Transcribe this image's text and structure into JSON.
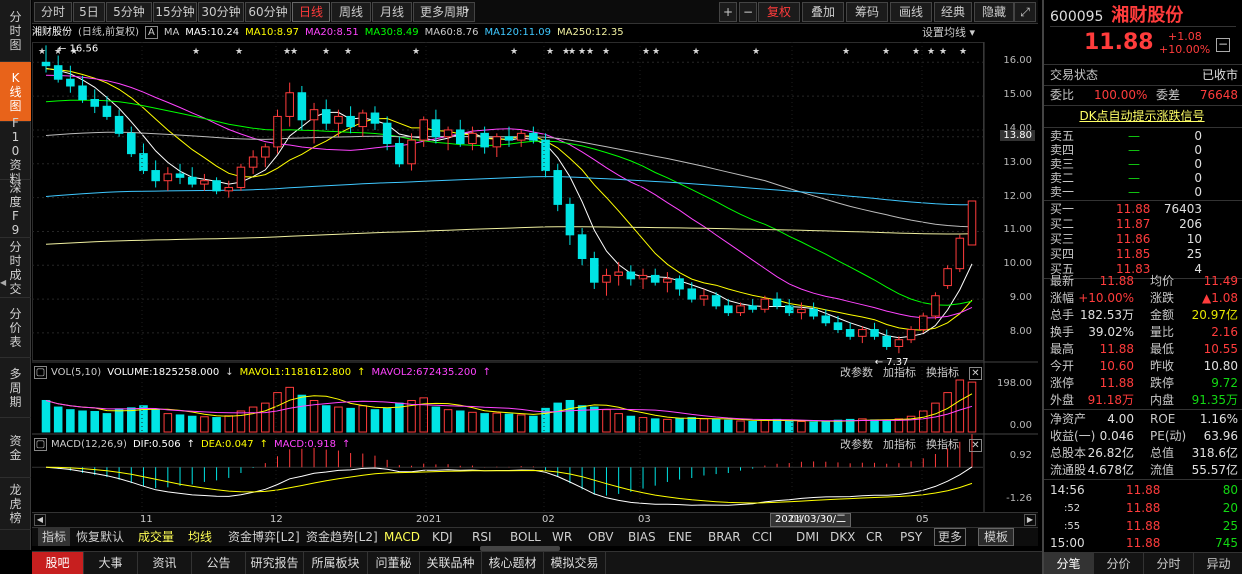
{
  "side_nav": [
    {
      "label": "分时图"
    },
    {
      "label": "K线图"
    },
    {
      "label": "F10资料"
    },
    {
      "label": "深度F9"
    },
    {
      "label": "分时成交"
    },
    {
      "label": "分价表"
    },
    {
      "label": "多周期"
    },
    {
      "label": "资金"
    },
    {
      "label": "龙虎榜"
    }
  ],
  "toolbar": {
    "periods": [
      "分时",
      "5日",
      "5分钟",
      "15分钟",
      "30分钟",
      "60分钟",
      "日线",
      "周线",
      "月线",
      "更多周期"
    ],
    "right": [
      "+",
      "−",
      "复权",
      "叠加",
      "筹码",
      "画线",
      "经典",
      "隐藏"
    ]
  },
  "chart_header": {
    "name": "湘财股份",
    "mode": "(日线,前复权)",
    "box": "A",
    "ma_label": "MA",
    "ma5": "MA5:10.24",
    "ma10": "MA10:8.97",
    "ma20": "MA20:8.51",
    "ma30": "MA30:8.49",
    "ma60": "MA60:8.76",
    "ma120": "MA120:11.09",
    "ma250": "MA250:12.35",
    "settings": "设置均线"
  },
  "price_axis": {
    "ticks": [
      "16.00",
      "15.00",
      "14.00",
      "13.80",
      "13.00",
      "12.00",
      "11.00",
      "10.00",
      "9.00",
      "8.00"
    ],
    "high_label": "16.56",
    "low_label": "7.37"
  },
  "volume_header": {
    "title": "VOL(5,10)",
    "volume": "VOLUME:1825258.000",
    "mavol1": "MAVOL1:1181612.800",
    "mavol2": "MAVOL2:672435.200"
  },
  "volume_axis": {
    "top": "198.00",
    "bottom": "0.00"
  },
  "macd_header": {
    "title": "MACD(12,26,9)",
    "dif": "DIF:0.506",
    "dea": "DEA:0.047",
    "macd": "MACD:0.918"
  },
  "macd_axis": {
    "top": "0.92",
    "bottom": "-1.26"
  },
  "sub_tools": {
    "t1": "改参数",
    "t2": "加指标",
    "t3": "换指标"
  },
  "date_bar": {
    "labels": [
      "11",
      "12",
      "2021",
      "02",
      "03",
      "04",
      "05"
    ],
    "current": "2021/03/30/二"
  },
  "indicator_tabs": [
    "指标",
    "恢复默认",
    "成交量",
    "均线",
    "资金博弈[L2]",
    "资金趋势[L2]",
    "MACD",
    "KDJ",
    "RSI",
    "BOLL",
    "WR",
    "OBV",
    "BIAS",
    "ENE",
    "BRAR",
    "CCI",
    "DMI",
    "DKX",
    "CR",
    "PSY",
    "更多",
    "模板"
  ],
  "bottom_tabs": [
    "股吧",
    "大事",
    "资讯",
    "公告",
    "研究报告",
    "所属板块",
    "问董秘",
    "关联品种",
    "核心题材",
    "模拟交易"
  ],
  "quote": {
    "code": "600095",
    "name": "湘财股份",
    "price": "11.88",
    "change": "+1.08",
    "pct": "+10.00%",
    "status_label": "交易状态",
    "status": "已收市",
    "weibi_label": "委比",
    "weibi": "100.00%",
    "weicha_label": "委差",
    "weicha": "76648",
    "signal": "DK点自动提示涨跌信号",
    "asks": [
      {
        "label": "卖五",
        "price": "—",
        "vol": "0"
      },
      {
        "label": "卖四",
        "price": "—",
        "vol": "0"
      },
      {
        "label": "卖三",
        "price": "—",
        "vol": "0"
      },
      {
        "label": "卖二",
        "price": "—",
        "vol": "0"
      },
      {
        "label": "卖一",
        "price": "—",
        "vol": "0"
      }
    ],
    "bids": [
      {
        "label": "买一",
        "price": "11.88",
        "vol": "76403"
      },
      {
        "label": "买二",
        "price": "11.87",
        "vol": "206"
      },
      {
        "label": "买三",
        "price": "11.86",
        "vol": "10"
      },
      {
        "label": "买四",
        "price": "11.85",
        "vol": "25"
      },
      {
        "label": "买五",
        "price": "11.83",
        "vol": "4"
      }
    ],
    "stats": [
      {
        "l1": "最新",
        "v1": "11.88",
        "c1": "red",
        "l2": "均价",
        "v2": "11.49",
        "c2": "red"
      },
      {
        "l1": "涨幅",
        "v1": "+10.00%",
        "c1": "red",
        "l2": "涨跌",
        "v2": "▲1.08",
        "c2": "red"
      },
      {
        "l1": "总手",
        "v1": "182.53万",
        "c1": "wht",
        "l2": "金额",
        "v2": "20.97亿",
        "c2": "yel"
      },
      {
        "l1": "换手",
        "v1": "39.02%",
        "c1": "wht",
        "l2": "量比",
        "v2": "2.16",
        "c2": "red"
      },
      {
        "l1": "最高",
        "v1": "11.88",
        "c1": "red",
        "l2": "最低",
        "v2": "10.55",
        "c2": "red"
      },
      {
        "l1": "今开",
        "v1": "10.60",
        "c1": "red",
        "l2": "昨收",
        "v2": "10.80",
        "c2": "wht"
      },
      {
        "l1": "涨停",
        "v1": "11.88",
        "c1": "red",
        "l2": "跌停",
        "v2": "9.72",
        "c2": "grn"
      },
      {
        "l1": "外盘",
        "v1": "91.18万",
        "c1": "red",
        "l2": "内盘",
        "v2": "91.35万",
        "c2": "grn"
      },
      {
        "l1": "净资产",
        "v1": "4.00",
        "c1": "wht",
        "l2": "ROE",
        "v2": "1.16%",
        "c2": "wht"
      },
      {
        "l1": "收益(一)",
        "v1": "0.046",
        "c1": "wht",
        "l2": "PE(动)",
        "v2": "63.96",
        "c2": "wht"
      },
      {
        "l1": "总股本",
        "v1": "26.82亿",
        "c1": "wht",
        "l2": "总值",
        "v2": "318.6亿",
        "c2": "wht"
      },
      {
        "l1": "流通股",
        "v1": "4.678亿",
        "c1": "wht",
        "l2": "流值",
        "v2": "55.57亿",
        "c2": "wht"
      }
    ],
    "ticks": [
      {
        "t": "14:56",
        "p": "11.88",
        "v": "80"
      },
      {
        "t": ":52",
        "p": "11.88",
        "v": "20"
      },
      {
        "t": ":55",
        "p": "11.88",
        "v": "25"
      },
      {
        "t": "15:00",
        "p": "11.88",
        "v": "745"
      }
    ],
    "tabs": [
      "分笔",
      "分价",
      "分时",
      "异动"
    ]
  },
  "colors": {
    "up": "#ff3c3c",
    "down": "#00e4e4",
    "ma5": "#ffffff",
    "ma10": "#ffff00",
    "ma20": "#ff44ff",
    "ma30": "#00ff00",
    "ma60": "#bbbbbb",
    "ma120": "#3fc8ff",
    "ma250": "#f0f0a0"
  },
  "chart_data": {
    "type": "candlestick",
    "ylim": [
      7.2,
      16.6
    ],
    "ohlc": [
      [
        16.0,
        16.5,
        15.7,
        15.9
      ],
      [
        15.9,
        16.2,
        15.4,
        15.5
      ],
      [
        15.5,
        15.9,
        15.1,
        15.3
      ],
      [
        15.3,
        15.6,
        14.8,
        14.9
      ],
      [
        14.9,
        15.2,
        14.5,
        14.7
      ],
      [
        14.7,
        15.0,
        14.3,
        14.4
      ],
      [
        14.4,
        14.6,
        13.8,
        13.9
      ],
      [
        13.9,
        14.1,
        13.2,
        13.3
      ],
      [
        13.3,
        13.6,
        12.7,
        12.8
      ],
      [
        12.8,
        13.1,
        12.3,
        12.5
      ],
      [
        12.5,
        12.9,
        12.2,
        12.7
      ],
      [
        12.7,
        13.0,
        12.4,
        12.6
      ],
      [
        12.6,
        12.9,
        12.3,
        12.4
      ],
      [
        12.4,
        12.7,
        12.2,
        12.5
      ],
      [
        12.5,
        12.6,
        12.1,
        12.2
      ],
      [
        12.2,
        12.5,
        12.0,
        12.3
      ],
      [
        12.3,
        13.0,
        12.2,
        12.9
      ],
      [
        12.9,
        13.4,
        12.7,
        13.2
      ],
      [
        13.2,
        13.6,
        12.9,
        13.5
      ],
      [
        13.5,
        14.6,
        13.3,
        14.4
      ],
      [
        14.4,
        15.4,
        14.1,
        15.1
      ],
      [
        15.1,
        15.3,
        14.0,
        14.3
      ],
      [
        14.3,
        14.8,
        13.6,
        14.6
      ],
      [
        14.6,
        14.9,
        14.0,
        14.2
      ],
      [
        14.2,
        14.6,
        13.8,
        14.4
      ],
      [
        14.4,
        14.7,
        13.9,
        14.1
      ],
      [
        14.1,
        14.6,
        13.8,
        14.5
      ],
      [
        14.5,
        14.7,
        14.0,
        14.2
      ],
      [
        14.2,
        14.4,
        13.4,
        13.6
      ],
      [
        13.6,
        13.8,
        12.9,
        13.0
      ],
      [
        13.0,
        13.9,
        12.8,
        13.7
      ],
      [
        13.7,
        14.4,
        13.5,
        14.3
      ],
      [
        14.3,
        14.6,
        13.6,
        13.8
      ],
      [
        13.8,
        14.1,
        13.4,
        14.0
      ],
      [
        14.0,
        14.3,
        13.5,
        13.6
      ],
      [
        13.6,
        14.1,
        13.4,
        13.9
      ],
      [
        13.9,
        14.1,
        13.3,
        13.5
      ],
      [
        13.5,
        13.9,
        13.2,
        13.8
      ],
      [
        13.8,
        14.1,
        13.5,
        13.7
      ],
      [
        13.7,
        14.0,
        13.5,
        13.9
      ],
      [
        13.9,
        14.1,
        13.6,
        13.7
      ],
      [
        13.7,
        13.9,
        12.6,
        12.8
      ],
      [
        12.8,
        13.0,
        11.6,
        11.8
      ],
      [
        11.8,
        12.0,
        10.6,
        10.9
      ],
      [
        10.9,
        11.1,
        10.0,
        10.2
      ],
      [
        10.2,
        10.4,
        9.3,
        9.5
      ],
      [
        9.5,
        9.9,
        9.1,
        9.7
      ],
      [
        9.7,
        10.1,
        9.4,
        9.8
      ],
      [
        9.8,
        10.0,
        9.4,
        9.6
      ],
      [
        9.6,
        9.9,
        9.3,
        9.7
      ],
      [
        9.7,
        9.9,
        9.4,
        9.5
      ],
      [
        9.5,
        9.8,
        9.2,
        9.6
      ],
      [
        9.6,
        9.7,
        9.1,
        9.3
      ],
      [
        9.3,
        9.5,
        8.9,
        9.0
      ],
      [
        9.0,
        9.3,
        8.8,
        9.1
      ],
      [
        9.1,
        9.2,
        8.7,
        8.8
      ],
      [
        8.8,
        9.0,
        8.5,
        8.6
      ],
      [
        8.6,
        8.9,
        8.5,
        8.8
      ],
      [
        8.8,
        9.0,
        8.6,
        8.7
      ],
      [
        8.7,
        9.1,
        8.6,
        9.0
      ],
      [
        9.0,
        9.2,
        8.7,
        8.8
      ],
      [
        8.8,
        9.0,
        8.5,
        8.6
      ],
      [
        8.6,
        8.9,
        8.4,
        8.7
      ],
      [
        8.7,
        8.9,
        8.4,
        8.5
      ],
      [
        8.5,
        8.7,
        8.2,
        8.3
      ],
      [
        8.3,
        8.5,
        8.0,
        8.1
      ],
      [
        8.1,
        8.3,
        7.8,
        7.9
      ],
      [
        7.9,
        8.2,
        7.7,
        8.1
      ],
      [
        8.1,
        8.3,
        7.8,
        7.9
      ],
      [
        7.9,
        8.1,
        7.5,
        7.6
      ],
      [
        7.6,
        7.9,
        7.4,
        7.8
      ],
      [
        7.8,
        8.2,
        7.7,
        8.1
      ],
      [
        8.1,
        8.6,
        8.0,
        8.5
      ],
      [
        8.5,
        9.2,
        8.4,
        9.1
      ],
      [
        9.4,
        10.0,
        9.3,
        9.9
      ],
      [
        9.9,
        10.9,
        9.8,
        10.8
      ],
      [
        10.6,
        11.9,
        10.6,
        11.9
      ]
    ],
    "volume": [
      120,
      95,
      85,
      80,
      78,
      70,
      88,
      92,
      100,
      85,
      70,
      65,
      60,
      58,
      55,
      62,
      80,
      95,
      110,
      150,
      170,
      140,
      120,
      100,
      95,
      90,
      100,
      85,
      90,
      110,
      120,
      130,
      95,
      85,
      80,
      75,
      70,
      72,
      68,
      65,
      60,
      90,
      110,
      120,
      100,
      95,
      85,
      70,
      60,
      55,
      50,
      48,
      52,
      55,
      50,
      48,
      45,
      42,
      40,
      45,
      48,
      42,
      40,
      38,
      40,
      45,
      48,
      50,
      46,
      44,
      50,
      60,
      80,
      110,
      150,
      198,
      190
    ]
  }
}
